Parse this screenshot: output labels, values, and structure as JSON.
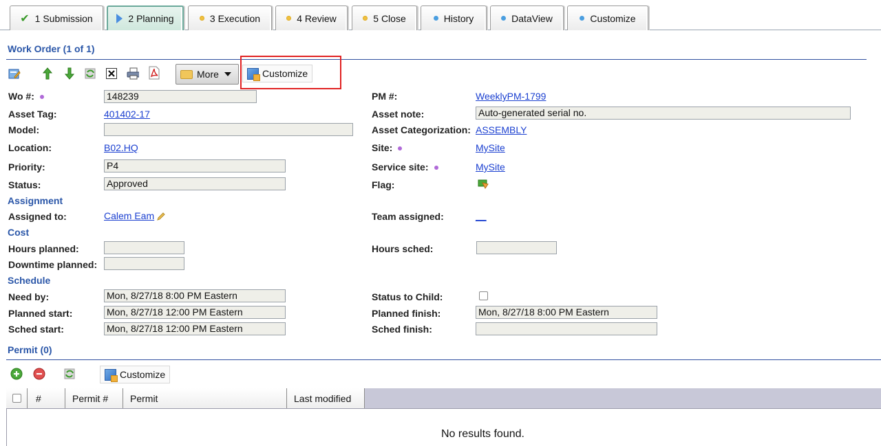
{
  "tabs": [
    {
      "label": "1 Submission",
      "marker": "check-icon",
      "active": false
    },
    {
      "label": "2 Planning",
      "marker": "play-icon",
      "active": true
    },
    {
      "label": "3 Execution",
      "marker": "yellow-dot",
      "active": false
    },
    {
      "label": "4 Review",
      "marker": "yellow-dot",
      "active": false
    },
    {
      "label": "5 Close",
      "marker": "yellow-dot",
      "active": false
    },
    {
      "label": "History",
      "marker": "blue-dot",
      "active": false
    },
    {
      "label": "DataView",
      "marker": "blue-dot",
      "active": false
    },
    {
      "label": "Customize",
      "marker": "blue-dot",
      "active": false
    }
  ],
  "work_order": {
    "title": "Work Order (1 of 1)",
    "toolbar": {
      "more_label": "More",
      "customize_label": "Customize",
      "icons": [
        "edit-icon",
        "move-up-icon",
        "move-down-icon",
        "refresh-icon",
        "close-icon",
        "print-icon",
        "pdf-icon"
      ]
    },
    "fields": {
      "wo_label": "Wo #:",
      "wo_value": "148239",
      "asset_tag_label": "Asset Tag:",
      "asset_tag_value": "401402-17",
      "model_label": "Model:",
      "model_value": "",
      "location_label": "Location:",
      "location_value": "B02.HQ",
      "priority_label": "Priority:",
      "priority_value": "P4",
      "status_label": "Status:",
      "status_value": "Approved",
      "pm_label": "PM #:",
      "pm_value": "WeeklyPM-1799",
      "asset_note_label": "Asset note:",
      "asset_note_value": "Auto-generated serial no.",
      "asset_cat_label": "Asset Categorization:",
      "asset_cat_value": "ASSEMBLY",
      "site_label": "Site:",
      "site_value": "MySite",
      "service_site_label": "Service site:",
      "service_site_value": "MySite",
      "flag_label": "Flag:"
    },
    "assignment": {
      "title": "Assignment",
      "assigned_to_label": "Assigned to:",
      "assigned_to_value": "Calem Eam",
      "team_label": "Team assigned:",
      "team_value": "__"
    },
    "cost": {
      "title": "Cost",
      "hours_planned_label": "Hours planned:",
      "hours_planned_value": "",
      "downtime_label": "Downtime planned:",
      "downtime_value": "",
      "hours_sched_label": "Hours sched:",
      "hours_sched_value": ""
    },
    "schedule": {
      "title": "Schedule",
      "need_by_label": "Need by:",
      "need_by_value": "Mon, 8/27/18 8:00 PM Eastern",
      "planned_start_label": "Planned start:",
      "planned_start_value": "Mon, 8/27/18 12:00 PM Eastern",
      "sched_start_label": "Sched start:",
      "sched_start_value": "Mon, 8/27/18 12:00 PM Eastern",
      "status_child_label": "Status to Child:",
      "planned_finish_label": "Planned finish:",
      "planned_finish_value": "Mon, 8/27/18 8:00 PM Eastern",
      "sched_finish_label": "Sched finish:",
      "sched_finish_value": ""
    }
  },
  "permit": {
    "title": "Permit (0)",
    "customize_label": "Customize",
    "columns": [
      "#",
      "Permit #",
      "Permit",
      "Last modified"
    ],
    "empty_text": "No results found."
  }
}
